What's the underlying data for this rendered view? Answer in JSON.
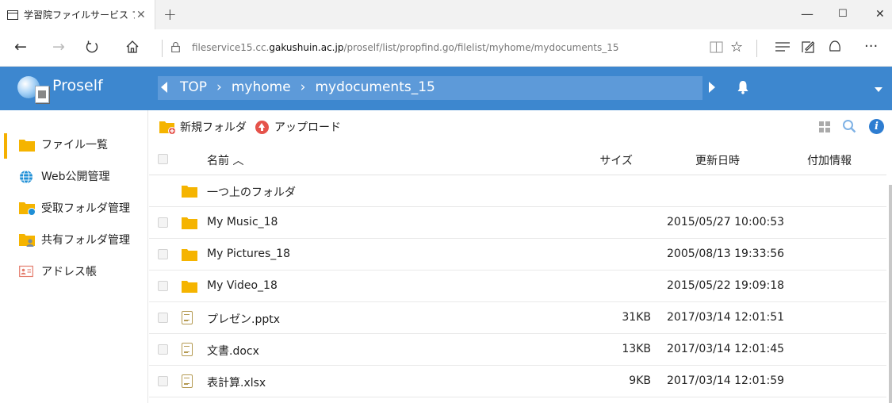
{
  "browser": {
    "tab_title": "学習院ファイルサービス ファ",
    "tab_close": "✕",
    "new_tab": "+",
    "url_prefix": "fileservice15.cc.",
    "url_host": "gakushuin.ac.jp",
    "url_path": "/proself/list/propfind.go/filelist/myhome/mydocuments_15",
    "window_controls": [
      "—",
      "☐",
      "✕"
    ],
    "toolbar_icons": [
      "reading-view-icon",
      "favorite-star-icon",
      "hub-icon",
      "web-note-icon",
      "share-icon",
      "more-icon"
    ]
  },
  "app": {
    "logo_text": "Proself",
    "breadcrumb": [
      "TOP",
      "myhome",
      "mydocuments_15"
    ],
    "breadcrumb_separator": "›"
  },
  "sidebar": {
    "items": [
      {
        "label": "ファイル一覧",
        "icon": "folder-icon",
        "active": true
      },
      {
        "label": "Web公開管理",
        "icon": "globe-icon",
        "active": false
      },
      {
        "label": "受取フォルダ管理",
        "icon": "receive-folder-icon",
        "active": false
      },
      {
        "label": "共有フォルダ管理",
        "icon": "shared-folder-icon",
        "active": false
      },
      {
        "label": "アドレス帳",
        "icon": "address-book-icon",
        "active": false
      }
    ]
  },
  "toolbar": {
    "new_folder_label": "新規フォルダ",
    "upload_label": "アップロード"
  },
  "table": {
    "headers": {
      "name": "名前 ︿",
      "size": "サイズ",
      "date": "更新日時",
      "extra": "付加情報"
    },
    "parent_label": "一つ上のフォルダ",
    "rows": [
      {
        "name": "My Music_18",
        "type": "folder",
        "size": "",
        "date": "2015/05/27 10:00:53"
      },
      {
        "name": "My Pictures_18",
        "type": "folder",
        "size": "",
        "date": "2005/08/13 19:33:56"
      },
      {
        "name": "My Video_18",
        "type": "folder",
        "size": "",
        "date": "2015/05/22 19:09:18"
      },
      {
        "name": "プレゼン.pptx",
        "type": "file",
        "size": "31KB",
        "date": "2017/03/14 12:01:51"
      },
      {
        "name": "文書.docx",
        "type": "file",
        "size": "13KB",
        "date": "2017/03/14 12:01:45"
      },
      {
        "name": "表計算.xlsx",
        "type": "file",
        "size": "9KB",
        "date": "2017/03/14 12:01:59"
      }
    ]
  },
  "colors": {
    "header_blue": "#3d87cf",
    "breadcrumb_blue": "#5d9ad9",
    "folder_yellow": "#f5b400",
    "active_bar": "#f5b000",
    "upload_red": "#e5534b",
    "info_blue": "#2e7dd1"
  }
}
